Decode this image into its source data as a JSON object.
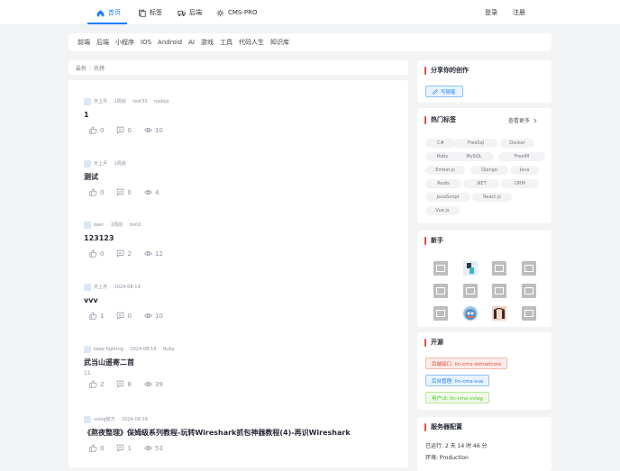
{
  "nav": {
    "items": [
      {
        "label": "首页",
        "icon": "home-icon",
        "active": true
      },
      {
        "label": "标签",
        "icon": "tag-icon",
        "active": false
      },
      {
        "label": "后端",
        "icon": "truck-icon",
        "active": false
      },
      {
        "label": "CMS-PRO",
        "icon": "sun-icon",
        "active": false
      }
    ],
    "login": "登录",
    "register": "注册"
  },
  "categories": [
    "前端",
    "后端",
    "小程序",
    "IOS",
    "Android",
    "AI",
    "游戏",
    "工具",
    "代码人生",
    "知识库"
  ],
  "sort": {
    "latest": "最新",
    "hot": "热榜"
  },
  "posts": [
    {
      "author": "天上月",
      "time": "1周前",
      "tags": [
        "test33",
        "nodejs"
      ],
      "title": "1",
      "summary": "",
      "likes": "0",
      "comments": "0",
      "views": "10"
    },
    {
      "author": "天上月",
      "time": "1周前",
      "tags": [],
      "title": "测试",
      "summary": "",
      "likes": "0",
      "comments": "0",
      "views": "4"
    },
    {
      "author": "qaer",
      "time": "2周前",
      "tags": [
        "test2"
      ],
      "title": "123123",
      "summary": "",
      "likes": "0",
      "comments": "2",
      "views": "12"
    },
    {
      "author": "天上月",
      "time": "2024-08-19",
      "tags": [],
      "title": "vvv",
      "summary": "",
      "likes": "1",
      "comments": "0",
      "views": "10"
    },
    {
      "author": "keep fighting",
      "time": "2024-08-19",
      "tags": [
        "Ruby"
      ],
      "title": "武当山遥寄二首",
      "summary": "11",
      "likes": "2",
      "comments": "8",
      "views": "39"
    },
    {
      "author": "vvlog官方",
      "time": "2024-08-16",
      "tags": [],
      "title": "《熬夜整理》保姆级系列教程-玩转Wireshark抓包神器教程(4)-再识Wireshark",
      "summary": "",
      "likes": "0",
      "comments": "1",
      "views": "53"
    }
  ],
  "share": {
    "title": "分享你的创作",
    "button": "写随笔"
  },
  "hot_tags": {
    "title": "热门标签",
    "more": "查看更多",
    "tags": [
      "C#",
      "FreeSql",
      "Docker",
      "Ruby",
      "MySQL",
      "FreeIM",
      "Ember.js",
      "Django",
      "Java",
      "Redis",
      ".NET",
      "ORM",
      "JavaScript",
      "React.js",
      "Vue.js"
    ]
  },
  "newbies": {
    "title": "新手"
  },
  "opensource": {
    "title": "开源",
    "links": [
      {
        "label": "后端接口: lin-cms-dotnetcore",
        "color": "#e74c3c",
        "bg": "#fdecea",
        "border": "#f5b7b1"
      },
      {
        "label": "后台管理: lin-cms-vue",
        "color": "#1e80ff",
        "bg": "#e8f3ff",
        "border": "#8ec2f8"
      },
      {
        "label": "用户UI: lin-cms-vvlog",
        "color": "#52c41a",
        "bg": "#f0f9eb",
        "border": "#b7eb8f"
      }
    ]
  },
  "server": {
    "title": "服务器配置",
    "uptime": "已运行: 2 天 14 时 46 分",
    "env": "环境: Production"
  },
  "colors": {
    "accent": "#1e80ff",
    "title_bar": "#e74c3c"
  }
}
